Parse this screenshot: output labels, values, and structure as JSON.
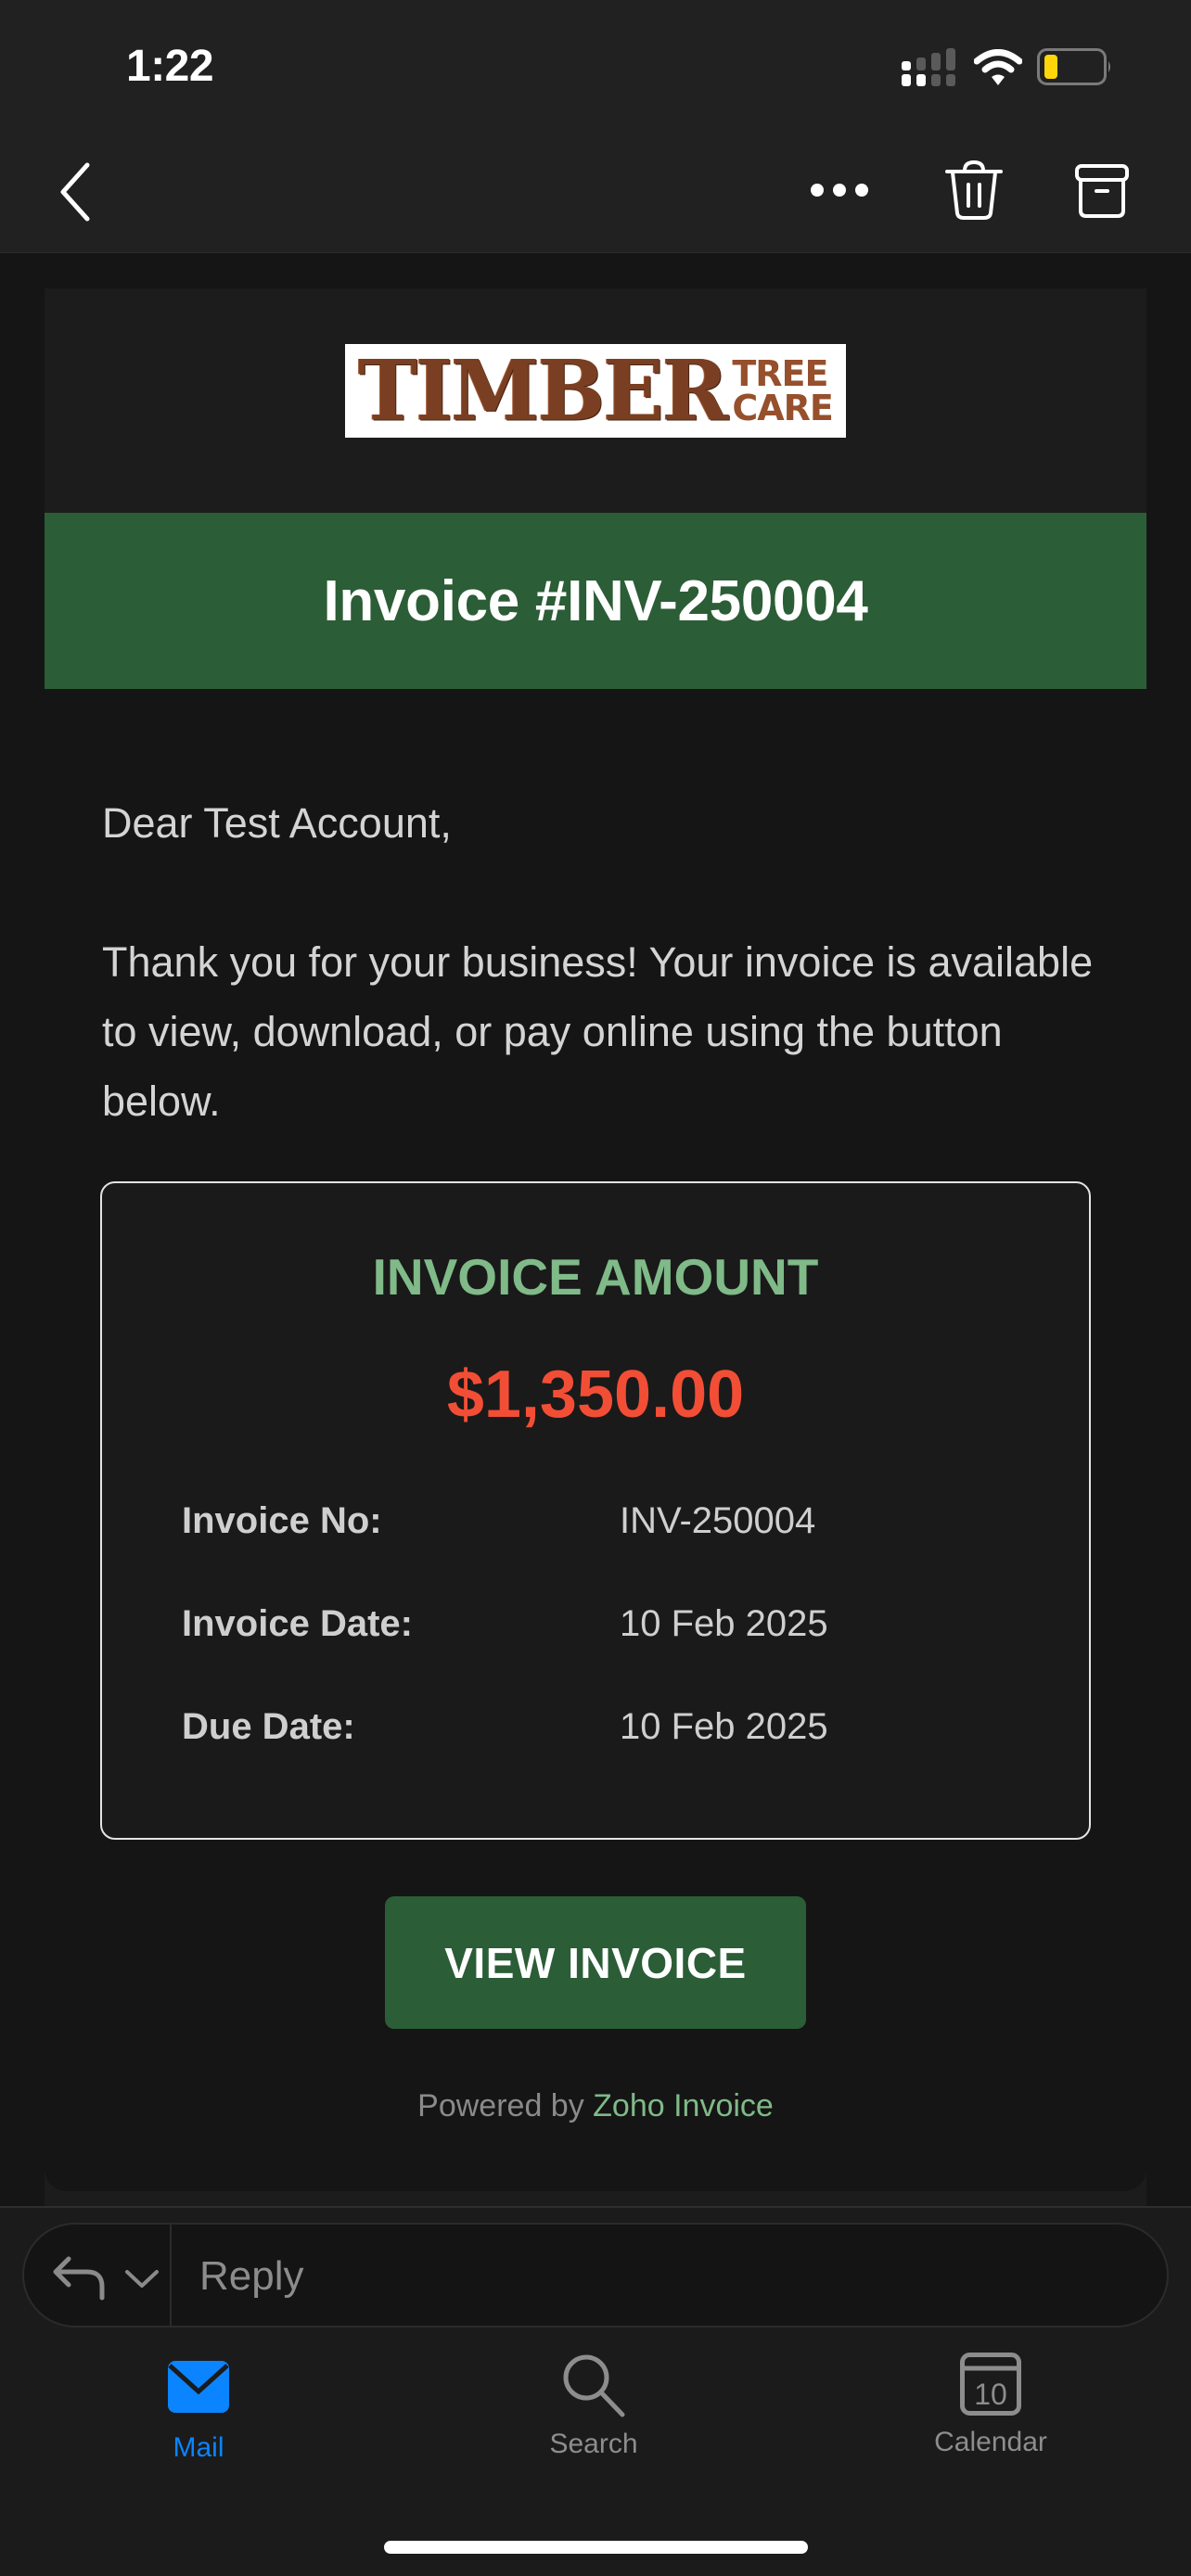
{
  "status_bar": {
    "time": "1:22",
    "icons": [
      "cellular-signal-icon",
      "wifi-icon",
      "battery-low-icon"
    ],
    "battery_color": "#ffd60a"
  },
  "nav": {
    "back_icon": "chevron-left-icon",
    "actions": [
      "more-icon",
      "trash-icon",
      "archive-icon"
    ]
  },
  "email": {
    "logo": {
      "main": "TIMBER",
      "sub_line1": "TREE",
      "sub_line2": "CARE"
    },
    "banner_title": "Invoice #INV-250004",
    "greeting": "Dear Test Account,",
    "message": "Thank you for your business! Your invoice is available to view, download, or pay online using the button below.",
    "invoice_box": {
      "amount_label": "INVOICE AMOUNT",
      "amount_value": "$1,350.00",
      "rows": [
        {
          "label": "Invoice No:",
          "value": "INV-250004"
        },
        {
          "label": "Invoice Date:",
          "value": "10 Feb 2025"
        },
        {
          "label": "Due Date:",
          "value": "10 Feb 2025"
        }
      ]
    },
    "view_button_label": "VIEW INVOICE",
    "powered_prefix": "Powered by ",
    "powered_link": "Zoho Invoice"
  },
  "reply_bar": {
    "placeholder": "Reply"
  },
  "tab_bar": {
    "tabs": [
      {
        "label": "Mail",
        "icon": "mail-icon",
        "active": true
      },
      {
        "label": "Search",
        "icon": "search-icon",
        "active": false
      },
      {
        "label": "Calendar",
        "icon": "calendar-icon",
        "active": false,
        "day": "10"
      }
    ]
  },
  "colors": {
    "brand_green": "#2b5d36",
    "accent_green": "#7fba88",
    "amount_red": "#f24e36",
    "active_tab_blue": "#0a84ff"
  }
}
